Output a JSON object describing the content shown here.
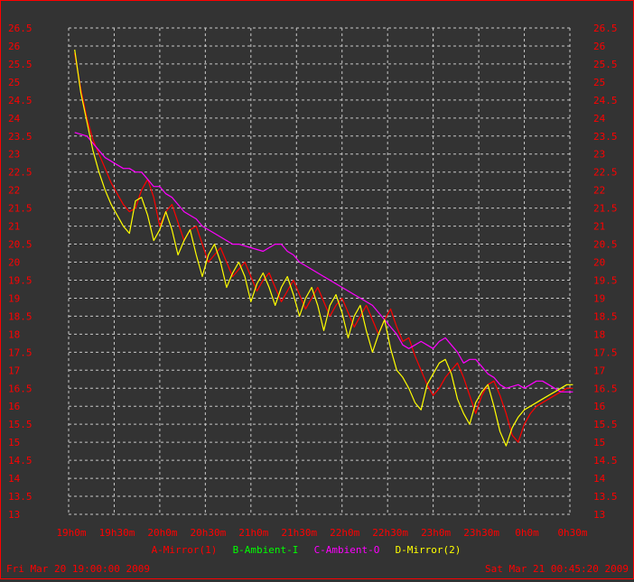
{
  "chart_data": {
    "type": "line",
    "title": "",
    "xlabel": "",
    "ylabel": "",
    "ylim": [
      13,
      26.5
    ],
    "y_ticks": [
      "13",
      "13.5",
      "14",
      "14.5",
      "15",
      "15.5",
      "16",
      "16.5",
      "17",
      "17.5",
      "18",
      "18.5",
      "19",
      "19.5",
      "20",
      "20.5",
      "21",
      "21.5",
      "22",
      "22.5",
      "23",
      "23.5",
      "24",
      "24.5",
      "25",
      "25.5",
      "26",
      "26.5"
    ],
    "x_ticks": [
      "19h0m",
      "19h30m",
      "20h0m",
      "20h30m",
      "21h0m",
      "21h30m",
      "22h0m",
      "22h30m",
      "23h0m",
      "23h30m",
      "0h0m",
      "0h30m"
    ],
    "x_tick_minutes": [
      0,
      30,
      60,
      90,
      120,
      150,
      180,
      210,
      240,
      270,
      300,
      330
    ],
    "xlim_minutes": [
      0,
      330
    ],
    "grid": true,
    "legend_position": "bottom",
    "start_label": "Fri Mar 20 19:00:00 2009",
    "end_label": "Sat Mar 21 00:45:20 2009",
    "series": [
      {
        "name": "A-Mirror(1)",
        "color": "#ff0000",
        "x": [
          4,
          8,
          12,
          16,
          20,
          24,
          28,
          32,
          36,
          40,
          44,
          48,
          52,
          56,
          60,
          64,
          68,
          72,
          76,
          80,
          84,
          88,
          92,
          96,
          100,
          104,
          108,
          112,
          116,
          120,
          124,
          128,
          132,
          136,
          140,
          144,
          148,
          152,
          156,
          160,
          164,
          168,
          172,
          176,
          180,
          184,
          188,
          192,
          196,
          200,
          204,
          208,
          212,
          216,
          220,
          224,
          228,
          232,
          236,
          240,
          244,
          248,
          252,
          256,
          260,
          264,
          268,
          272,
          276,
          280,
          284,
          288,
          292,
          296,
          300,
          304,
          308,
          312,
          316,
          320,
          324,
          328,
          332
        ],
        "values": [
          25.8,
          24.8,
          24,
          23.4,
          23,
          22.6,
          22.2,
          21.9,
          21.6,
          21.4,
          21.5,
          22.0,
          22.3,
          21.8,
          21.0,
          21.4,
          21.6,
          21.1,
          20.6,
          20.9,
          21.0,
          20.5,
          20.0,
          20.2,
          20.4,
          20.0,
          19.6,
          19.8,
          20.0,
          19.6,
          19.2,
          19.5,
          19.7,
          19.3,
          18.9,
          19.2,
          19.5,
          19.1,
          18.7,
          19.0,
          19.3,
          18.9,
          18.5,
          18.8,
          19.0,
          18.6,
          18.2,
          18.5,
          18.8,
          18.4,
          18.0,
          18.4,
          18.7,
          18.2,
          17.8,
          17.9,
          17.4,
          17.0,
          16.6,
          16.3,
          16.5,
          16.8,
          17.0,
          17.2,
          16.8,
          16.3,
          15.8,
          16.3,
          16.6,
          16.7,
          16.3,
          15.8,
          15.2,
          15.0,
          15.5,
          15.8,
          16.0,
          16.1,
          16.2,
          16.3,
          16.4,
          16.5,
          16.5
        ]
      },
      {
        "name": "B-Ambient-I",
        "color": "#00ff00",
        "x": [],
        "values": []
      },
      {
        "name": "C-Ambient-O",
        "color": "#ff00ff",
        "x": [
          4,
          8,
          12,
          16,
          20,
          24,
          28,
          32,
          36,
          40,
          44,
          48,
          52,
          56,
          60,
          64,
          68,
          72,
          76,
          80,
          84,
          88,
          92,
          96,
          100,
          104,
          108,
          112,
          116,
          120,
          124,
          128,
          132,
          136,
          140,
          144,
          148,
          152,
          156,
          160,
          164,
          168,
          172,
          176,
          180,
          184,
          188,
          192,
          196,
          200,
          204,
          208,
          212,
          216,
          220,
          224,
          228,
          232,
          236,
          240,
          244,
          248,
          252,
          256,
          260,
          264,
          268,
          272,
          276,
          280,
          284,
          288,
          292,
          296,
          300,
          304,
          308,
          312,
          316,
          320,
          324,
          328,
          332
        ],
        "values": [
          23.6,
          23.55,
          23.5,
          23.3,
          23.1,
          22.9,
          22.8,
          22.7,
          22.6,
          22.6,
          22.5,
          22.5,
          22.3,
          22.1,
          22.1,
          21.9,
          21.8,
          21.6,
          21.4,
          21.3,
          21.2,
          21.0,
          20.9,
          20.8,
          20.7,
          20.6,
          20.5,
          20.5,
          20.45,
          20.4,
          20.35,
          20.3,
          20.4,
          20.5,
          20.5,
          20.3,
          20.2,
          20.0,
          19.9,
          19.8,
          19.7,
          19.6,
          19.5,
          19.4,
          19.3,
          19.2,
          19.1,
          19.0,
          18.9,
          18.8,
          18.6,
          18.4,
          18.2,
          18.0,
          17.7,
          17.6,
          17.7,
          17.8,
          17.7,
          17.6,
          17.8,
          17.9,
          17.7,
          17.5,
          17.2,
          17.3,
          17.3,
          17.1,
          16.9,
          16.8,
          16.6,
          16.5,
          16.55,
          16.6,
          16.5,
          16.6,
          16.7,
          16.7,
          16.6,
          16.5,
          16.4,
          16.4,
          16.4
        ]
      },
      {
        "name": "D-Mirror(2)",
        "color": "#ffff00",
        "x": [
          4,
          8,
          12,
          16,
          20,
          24,
          28,
          32,
          36,
          40,
          44,
          48,
          52,
          56,
          60,
          64,
          68,
          72,
          76,
          80,
          84,
          88,
          92,
          96,
          100,
          104,
          108,
          112,
          116,
          120,
          124,
          128,
          132,
          136,
          140,
          144,
          148,
          152,
          156,
          160,
          164,
          168,
          172,
          176,
          180,
          184,
          188,
          192,
          196,
          200,
          204,
          208,
          212,
          216,
          220,
          224,
          228,
          232,
          236,
          240,
          244,
          248,
          252,
          256,
          260,
          264,
          268,
          272,
          276,
          280,
          284,
          288,
          292,
          296,
          300,
          304,
          308,
          312,
          316,
          320,
          324,
          328,
          332
        ],
        "values": [
          25.9,
          24.7,
          23.9,
          23.1,
          22.5,
          22.0,
          21.6,
          21.3,
          21.0,
          20.8,
          21.7,
          21.8,
          21.3,
          20.6,
          20.9,
          21.4,
          20.9,
          20.2,
          20.6,
          20.9,
          20.2,
          19.6,
          20.2,
          20.5,
          20.0,
          19.3,
          19.7,
          20.0,
          19.6,
          18.9,
          19.4,
          19.7,
          19.3,
          18.8,
          19.3,
          19.6,
          19.1,
          18.5,
          19.0,
          19.3,
          18.8,
          18.1,
          18.8,
          19.1,
          18.6,
          17.9,
          18.5,
          18.8,
          18.1,
          17.5,
          18.0,
          18.4,
          17.6,
          17.0,
          16.8,
          16.5,
          16.1,
          15.9,
          16.6,
          16.9,
          17.2,
          17.3,
          16.9,
          16.2,
          15.8,
          15.5,
          16.1,
          16.4,
          16.6,
          16.0,
          15.3,
          14.9,
          15.4,
          15.7,
          15.9,
          16.0,
          16.1,
          16.2,
          16.3,
          16.4,
          16.5,
          16.6,
          16.6
        ]
      }
    ]
  }
}
